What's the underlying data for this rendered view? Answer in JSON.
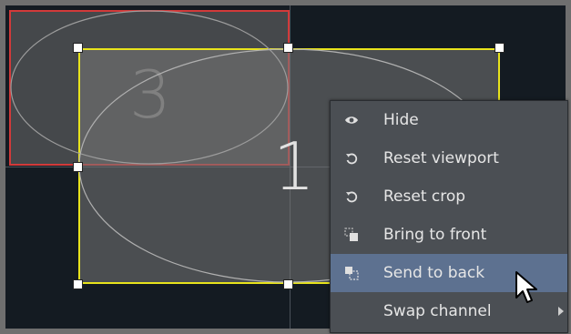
{
  "viewports": [
    {
      "label": "3",
      "selected": false,
      "border_color": "#d23a3a"
    },
    {
      "label": "1",
      "selected": true,
      "border_color": "#e8e31c"
    }
  ],
  "context_menu": {
    "items": [
      {
        "label": "Hide",
        "icon": "eye-icon"
      },
      {
        "label": "Reset viewport",
        "icon": "reset-icon"
      },
      {
        "label": "Reset crop",
        "icon": "reset-icon"
      },
      {
        "label": "Bring to front",
        "icon": "bring-to-front-icon"
      },
      {
        "label": "Send to back",
        "icon": "send-to-back-icon",
        "highlighted": true
      },
      {
        "label": "Swap channel",
        "icon": "",
        "submenu": true
      }
    ],
    "highlight_color": "#5d7190"
  }
}
